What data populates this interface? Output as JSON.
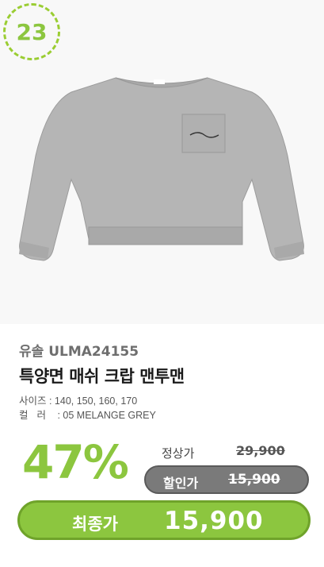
{
  "rank": "23",
  "product": {
    "brand_model": "유솔 ULMA24155",
    "name": "특양면 매쉬 크랍 맨투맨",
    "sizes": "사이즈 : 140, 150, 160, 170",
    "color_label": "컬러",
    "color_value": " : 05 MELANGE GREY",
    "image_icon": "grey-crewneck-sweatshirt"
  },
  "pricing": {
    "discount": "47%",
    "regular_label": "정상가",
    "regular_price": "29,900",
    "sale_label": "할인가",
    "sale_price": "15,900",
    "final_label": "최종가",
    "final_price": "15,900"
  },
  "colors": {
    "accent": "#8cc63f",
    "sale_pill": "#7a7a7a",
    "sweatshirt": "#b5b5b5"
  }
}
